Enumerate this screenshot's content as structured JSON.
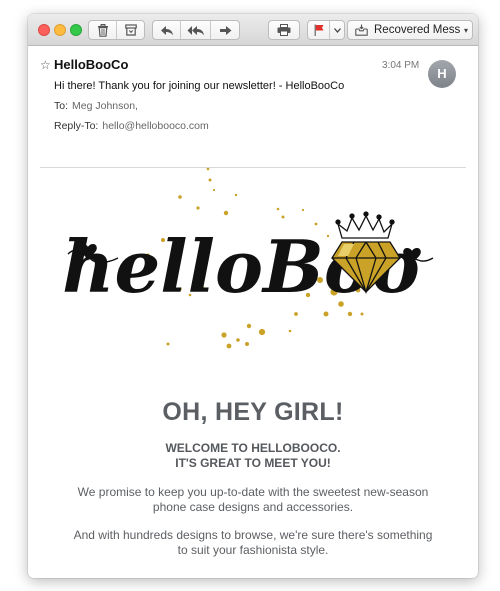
{
  "toolbar": {
    "mailbox_label": "Recovered Mess…"
  },
  "message": {
    "sender": "HelloBooCo",
    "time": "3:04 PM",
    "avatar_initial": "H",
    "subject": "Hi there! Thank you for joining our newsletter! - HelloBooCo",
    "to_label": "To:",
    "to_value": "Meg Johnson,",
    "reply_label": "Reply-To:",
    "reply_value": "hello@hellobooco.com"
  },
  "body": {
    "logo_text": "helloBoo",
    "headline": "OH, HEY GIRL!",
    "welcome_line1": "WELCOME TO HELLOBOOCO.",
    "welcome_line2": "IT'S GREAT TO MEET YOU!",
    "para1_line1": "We promise to keep you up-to-date with the sweetest new-season",
    "para1_line2": "phone case designs and accessories.",
    "para2_line1": "And with hundreds designs to browse, we're sure there's something",
    "para2_line2": "to suit your fashionista style."
  },
  "colors": {
    "headline": "#5b5e62",
    "gold": "#c9a227",
    "flag_red": "#e0322c"
  },
  "icons": [
    "trash-icon",
    "archive-icon",
    "reply-icon",
    "reply-all-icon",
    "forward-icon",
    "print-icon",
    "flag-icon",
    "chevron-down-icon",
    "mailbox-icon",
    "star-icon",
    "heart-icon",
    "crown-icon",
    "diamond-icon"
  ]
}
